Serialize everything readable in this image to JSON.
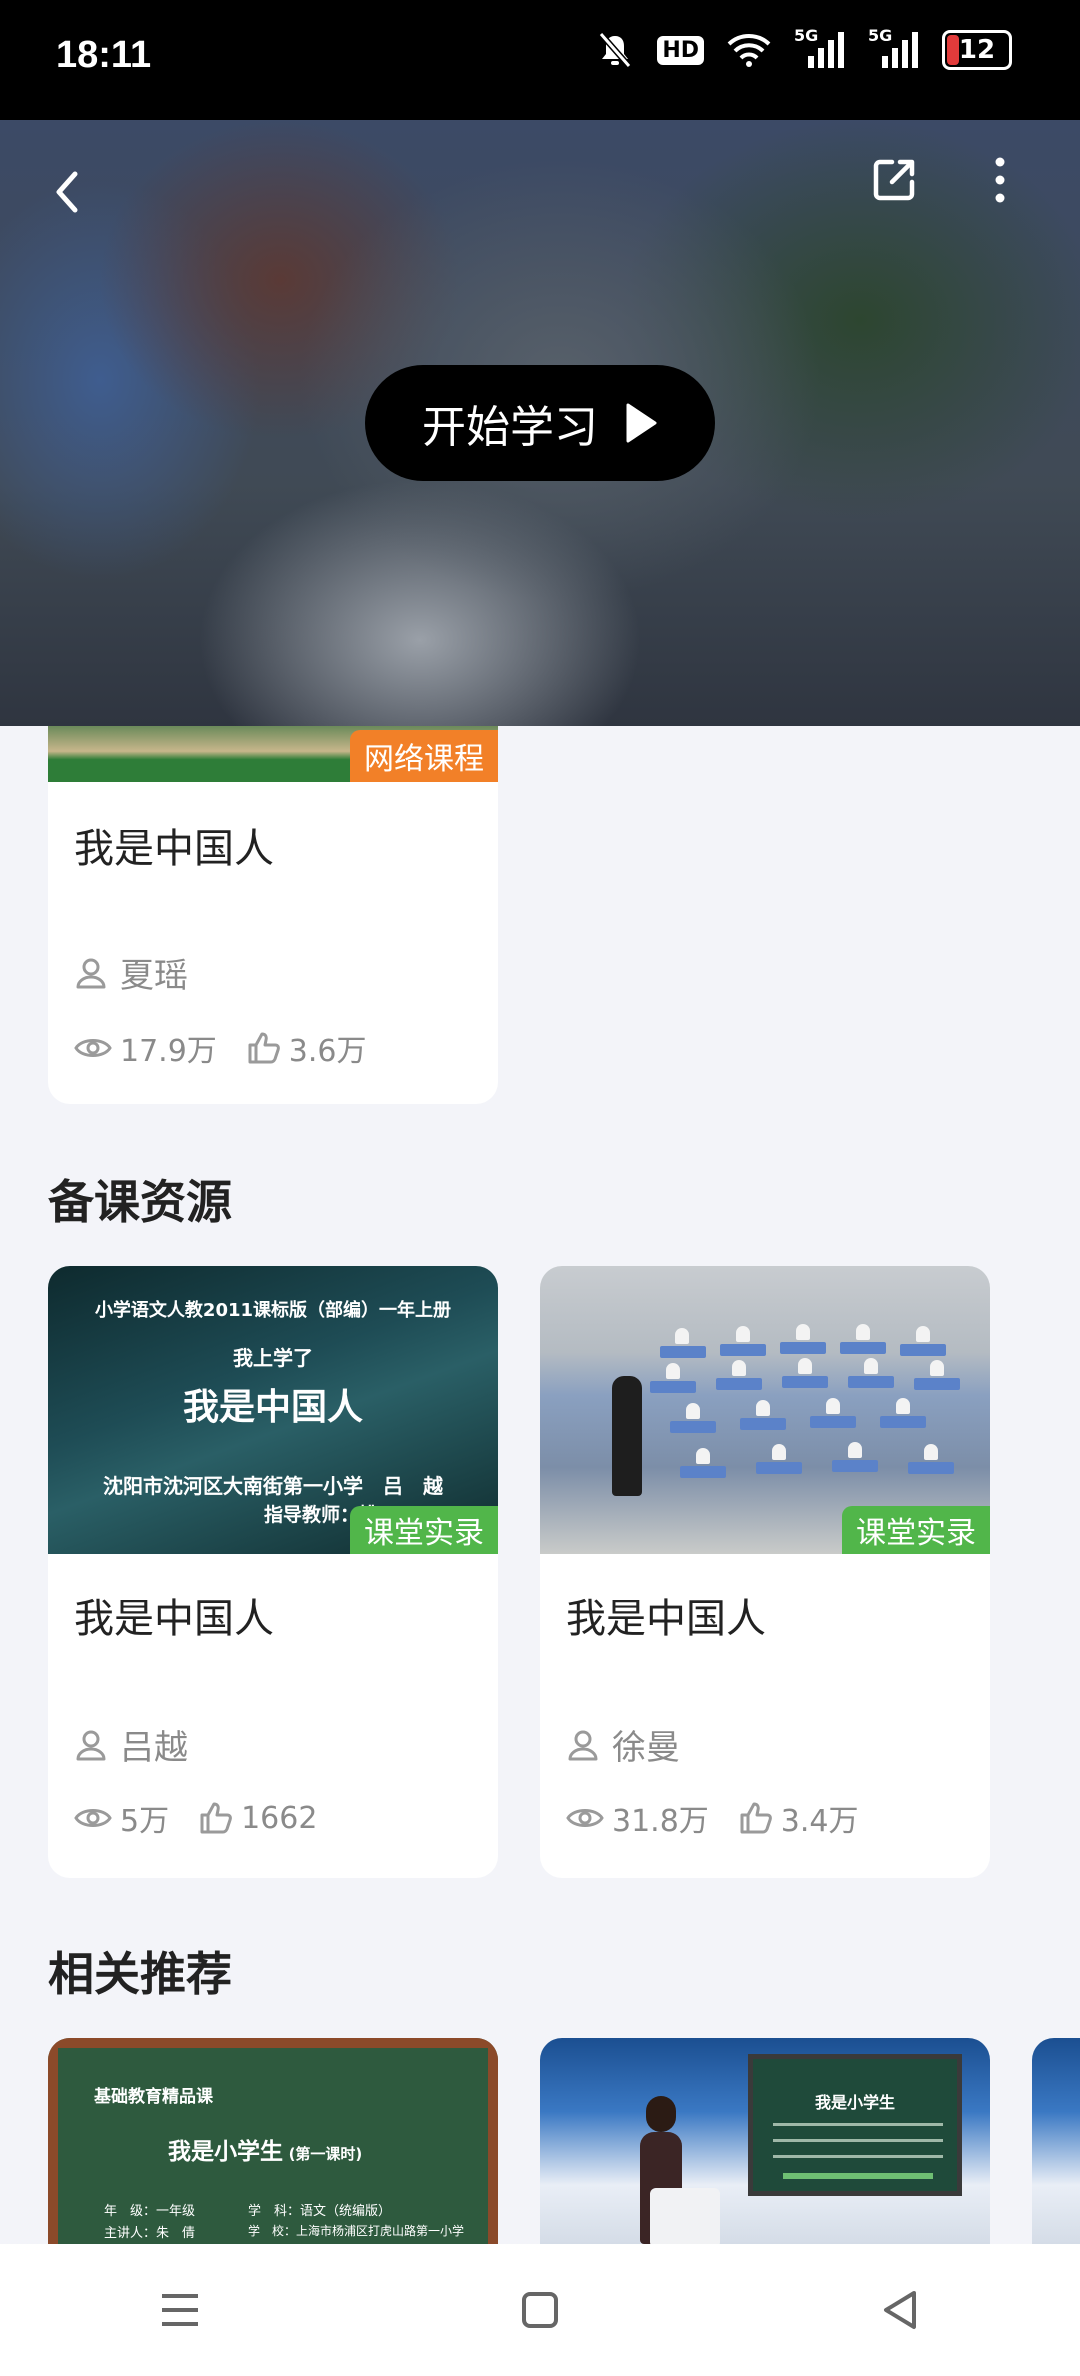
{
  "status_bar": {
    "time": "18:11",
    "signal_labels": [
      "5G",
      "5G"
    ],
    "hd_label": "HD",
    "battery_level": "12",
    "battery_color": "#e13b3b"
  },
  "hero": {
    "start_button_label": "开始学习"
  },
  "first_card": {
    "badge": "网络课程",
    "badge_color": "#f28028",
    "title": "我是中国人",
    "author": "夏瑶",
    "views": "17.9万",
    "likes": "3.6万"
  },
  "prep_resources": {
    "title": "备课资源",
    "cards": [
      {
        "badge": "课堂实录",
        "badge_color": "#51b64a",
        "title": "我是中国人",
        "author": "吕越",
        "views": "5万",
        "likes": "1662",
        "thumb_lines": [
          "小学语文人教2011课标版（部编）一年上册",
          "我上学了",
          "我是中国人",
          "沈阳市沈河区大南街第一小学　吕　越",
          "指导教师：姚"
        ]
      },
      {
        "badge": "课堂实录",
        "badge_color": "#51b64a",
        "title": "我是中国人",
        "author": "徐曼",
        "views": "31.8万",
        "likes": "3.4万"
      }
    ]
  },
  "related": {
    "title": "相关推荐",
    "cards": [
      {
        "thumb_lines": [
          "基础教育精品课",
          "我是小学生",
          "(第一课时)",
          "年　级：一年级",
          "学　科：语文（统编版）",
          "主讲人：朱　倩",
          "学　校：上海市杨浦区打虎山路第一小学"
        ]
      },
      {
        "thumb_lines": [
          "我是小学生"
        ]
      }
    ]
  }
}
